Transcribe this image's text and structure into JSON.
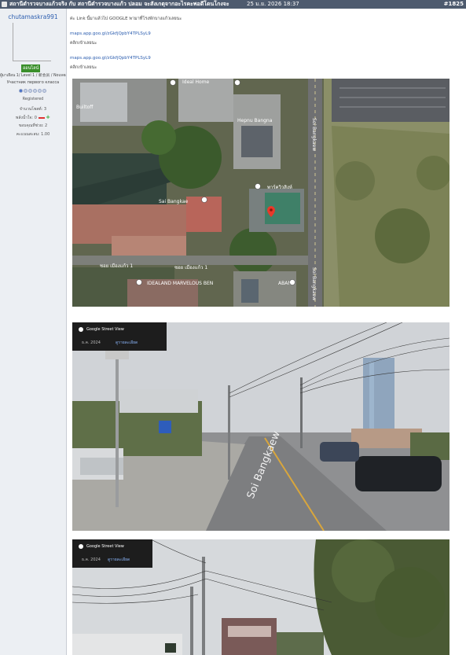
{
  "header": {
    "title": "สถานีตำรวจบางแก้วจริง กับ สถานีตำรวจบางแก้ว ปลอม จะสังเกตุจากอะไรคะพอดีโดนโกงจะ",
    "date": "25 ม.ย. 2026 18:37",
    "post_number": "#1825"
  },
  "sidebar": {
    "username": "chutamaskra991",
    "online_badge": "ออนไลน์",
    "rank": "ผู้มาเยือน 1/ Level 1 / 新会员 / Nouveau membre",
    "rank2": "Участник первого класса",
    "status": "Registered",
    "stats": [
      {
        "label": "จำนวนโพสต์:",
        "value": "3"
      },
      {
        "label": "พลังน้ำใจ:",
        "value": "0"
      },
      {
        "label": "ขอบคุณที่ช่วย:",
        "value": "2"
      },
      {
        "label": "คะแนนสะสม:",
        "value": "1.00"
      }
    ]
  },
  "post": {
    "intro": "ค่ะ Link นี้มาแล้วไป GOOGLE พามาที่โรงพักบางแก้วเลยนะ",
    "link1": "maps.app.goo.gl/zGkfjQpbY4TPLSyL9",
    "caption1": "คลิกเข้าเลยนะ",
    "link2": "maps.app.goo.gl/zGkfjQpbY4TPLSyL9",
    "caption2": "คลิกเข้าเลยนะ"
  },
  "map": {
    "labels": [
      "Ideal Home",
      "Builtoff",
      "Hepnu Bangna",
      "พาร์ควิวสิงห์",
      "Sai Bangkae",
      "ซอย เมืองแก้ว 1",
      "ซอย เมืองแก้ว 1",
      "IDEALAND MARVELOUS BEN",
      "ABAN",
      "Soi Bangkaew",
      "Soi Bangkaew"
    ]
  },
  "streetview1": {
    "badge": "Google Street View",
    "date": "ธ.ค. 2024",
    "link": "ดูรายละเอียด",
    "road_text": "Soi Bangkaew"
  },
  "streetview2": {
    "badge": "Google Street View",
    "date": "ธ.ค. 2024",
    "link": "ดูรายละเอียด"
  }
}
